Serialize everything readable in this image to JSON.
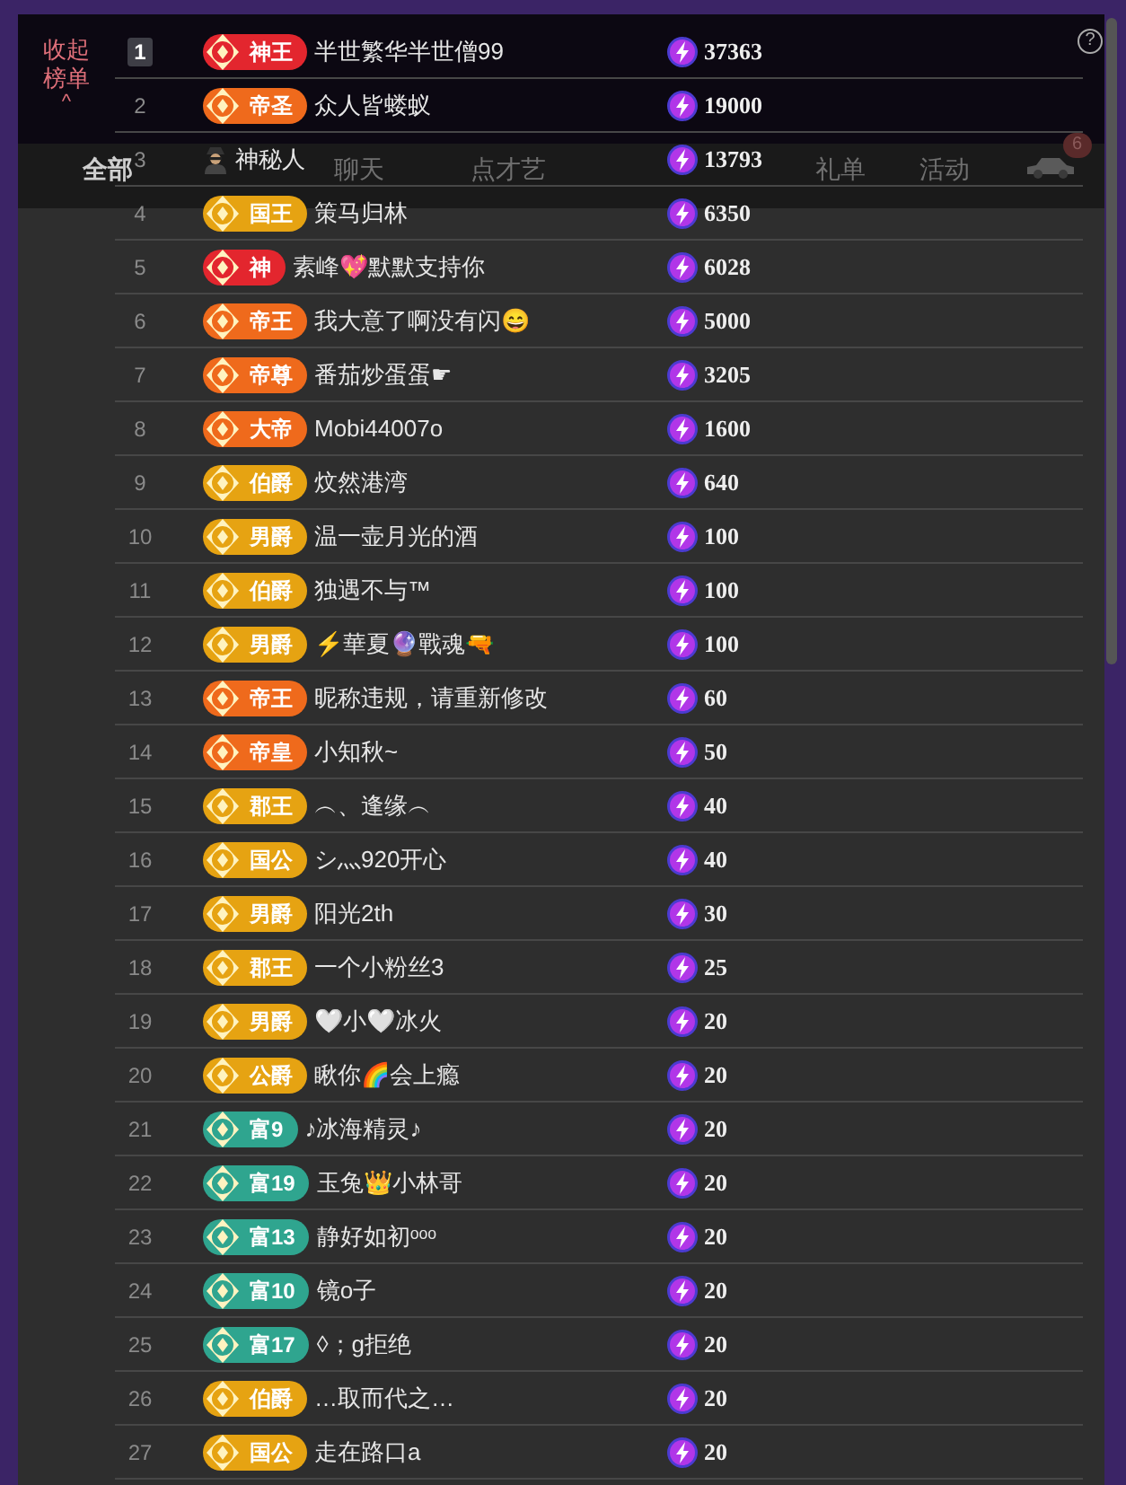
{
  "collapse_label": "收起榜单",
  "collapse_caret": "^",
  "help": "?",
  "tabs": [
    {
      "label": "全部",
      "selected": true
    },
    {
      "label": "聊天",
      "selected": false
    },
    {
      "label": "点才艺",
      "selected": false
    },
    {
      "label": "礼单",
      "selected": false
    },
    {
      "label": "活动",
      "selected": false
    }
  ],
  "garage_badge": "6",
  "rows": [
    {
      "rank": "1",
      "rank_boxed": true,
      "anonymous": false,
      "badge": {
        "text": "神王",
        "color": "#e3262e"
      },
      "name": "半世繁华半世僧99",
      "score": "37363"
    },
    {
      "rank": "2",
      "rank_boxed": false,
      "anonymous": false,
      "badge": {
        "text": "帝圣",
        "color": "#ef6a1c"
      },
      "name": "众人皆蝼蚁",
      "score": "19000"
    },
    {
      "rank": "3",
      "rank_boxed": false,
      "anonymous": true,
      "name": "神秘人",
      "score": "13793"
    },
    {
      "rank": "4",
      "rank_boxed": false,
      "anonymous": false,
      "badge": {
        "text": "国王",
        "color": "#e6a312"
      },
      "name": "策马归林",
      "score": "6350"
    },
    {
      "rank": "5",
      "rank_boxed": false,
      "anonymous": false,
      "badge": {
        "text": "神",
        "color": "#e3262e"
      },
      "name": "素峰💖默默支持你",
      "score": "6028"
    },
    {
      "rank": "6",
      "rank_boxed": false,
      "anonymous": false,
      "badge": {
        "text": "帝王",
        "color": "#ef6a1c"
      },
      "name": "我大意了啊没有闪😄",
      "score": "5000"
    },
    {
      "rank": "7",
      "rank_boxed": false,
      "anonymous": false,
      "badge": {
        "text": "帝尊",
        "color": "#ef6a1c"
      },
      "name": "番茄炒蛋蛋☛",
      "score": "3205"
    },
    {
      "rank": "8",
      "rank_boxed": false,
      "anonymous": false,
      "badge": {
        "text": "大帝",
        "color": "#ef6a1c"
      },
      "name": "Mobi44007o",
      "score": "1600"
    },
    {
      "rank": "9",
      "rank_boxed": false,
      "anonymous": false,
      "badge": {
        "text": "伯爵",
        "color": "#e6a312"
      },
      "name": "炆然港湾",
      "score": "640"
    },
    {
      "rank": "10",
      "rank_boxed": false,
      "anonymous": false,
      "badge": {
        "text": "男爵",
        "color": "#e6a312"
      },
      "name": "温一壶月光的酒",
      "score": "100"
    },
    {
      "rank": "11",
      "rank_boxed": false,
      "anonymous": false,
      "badge": {
        "text": "伯爵",
        "color": "#e6a312"
      },
      "name": "独遇不与™",
      "score": "100"
    },
    {
      "rank": "12",
      "rank_boxed": false,
      "anonymous": false,
      "badge": {
        "text": "男爵",
        "color": "#e6a312"
      },
      "name": "⚡華夏🔮戰魂🔫",
      "score": "100"
    },
    {
      "rank": "13",
      "rank_boxed": false,
      "anonymous": false,
      "badge": {
        "text": "帝王",
        "color": "#ef6a1c"
      },
      "name": "昵称违规，请重新修改",
      "score": "60"
    },
    {
      "rank": "14",
      "rank_boxed": false,
      "anonymous": false,
      "badge": {
        "text": "帝皇",
        "color": "#ef6a1c"
      },
      "name": "小知秋~",
      "score": "50"
    },
    {
      "rank": "15",
      "rank_boxed": false,
      "anonymous": false,
      "badge": {
        "text": "郡王",
        "color": "#e6a312"
      },
      "name": "︵、逢缘︵",
      "score": "40"
    },
    {
      "rank": "16",
      "rank_boxed": false,
      "anonymous": false,
      "badge": {
        "text": "国公",
        "color": "#e6a312"
      },
      "name": "シ灬920开心",
      "score": "40"
    },
    {
      "rank": "17",
      "rank_boxed": false,
      "anonymous": false,
      "badge": {
        "text": "男爵",
        "color": "#e6a312"
      },
      "name": "阳光2th",
      "score": "30"
    },
    {
      "rank": "18",
      "rank_boxed": false,
      "anonymous": false,
      "badge": {
        "text": "郡王",
        "color": "#e6a312"
      },
      "name": "一个小粉丝3",
      "score": "25"
    },
    {
      "rank": "19",
      "rank_boxed": false,
      "anonymous": false,
      "badge": {
        "text": "男爵",
        "color": "#e6a312"
      },
      "name": "🤍小🤍冰火",
      "score": "20"
    },
    {
      "rank": "20",
      "rank_boxed": false,
      "anonymous": false,
      "badge": {
        "text": "公爵",
        "color": "#e6a312"
      },
      "name": "瞅你🌈会上瘾",
      "score": "20"
    },
    {
      "rank": "21",
      "rank_boxed": false,
      "anonymous": false,
      "badge": {
        "text": "富9",
        "color": "#2fa58f"
      },
      "name": "♪冰海精灵♪",
      "score": "20"
    },
    {
      "rank": "22",
      "rank_boxed": false,
      "anonymous": false,
      "badge": {
        "text": "富19",
        "color": "#2fa58f"
      },
      "name": "玉兔👑小林哥",
      "score": "20"
    },
    {
      "rank": "23",
      "rank_boxed": false,
      "anonymous": false,
      "badge": {
        "text": "富13",
        "color": "#2fa58f"
      },
      "name": "静好如初ᵒᵒᵒ",
      "score": "20"
    },
    {
      "rank": "24",
      "rank_boxed": false,
      "anonymous": false,
      "badge": {
        "text": "富10",
        "color": "#2fa58f"
      },
      "name": "镜o子",
      "score": "20"
    },
    {
      "rank": "25",
      "rank_boxed": false,
      "anonymous": false,
      "badge": {
        "text": "富17",
        "color": "#2fa58f"
      },
      "name": "◊；g拒绝",
      "score": "20"
    },
    {
      "rank": "26",
      "rank_boxed": false,
      "anonymous": false,
      "badge": {
        "text": "伯爵",
        "color": "#e6a312"
      },
      "name": "…取而代之…",
      "score": "20"
    },
    {
      "rank": "27",
      "rank_boxed": false,
      "anonymous": false,
      "badge": {
        "text": "国公",
        "color": "#e6a312"
      },
      "name": "走在路口a",
      "score": "20"
    }
  ]
}
